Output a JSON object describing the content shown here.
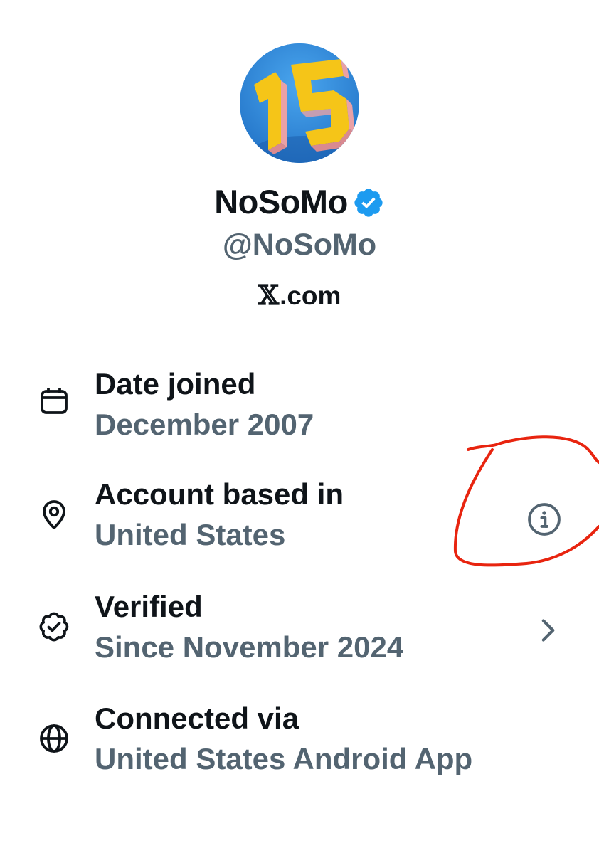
{
  "profile": {
    "display_name": "NoSoMo",
    "handle": "@NoSoMo",
    "source_label": ".com",
    "source_logo": "𝕏",
    "avatar_icon": "number-15-avatar-icon",
    "verified_icon": "verified-badge-icon"
  },
  "details": [
    {
      "title": "Date joined",
      "value": "December 2007",
      "icon": "calendar-icon"
    },
    {
      "title": "Account based in",
      "value": "United States",
      "icon": "location-pin-icon",
      "trailing_icon": "info-icon"
    },
    {
      "title": "Verified",
      "value": "Since November 2024",
      "icon": "verified-outline-icon",
      "trailing_icon": "chevron-right-icon"
    },
    {
      "title": "Connected via",
      "value": "United States Android App",
      "icon": "globe-icon"
    }
  ],
  "colors": {
    "primary_text": "#0f1419",
    "secondary_text": "#536471",
    "verified_blue": "#1d9bf0",
    "annotation_red": "#e8240f"
  }
}
